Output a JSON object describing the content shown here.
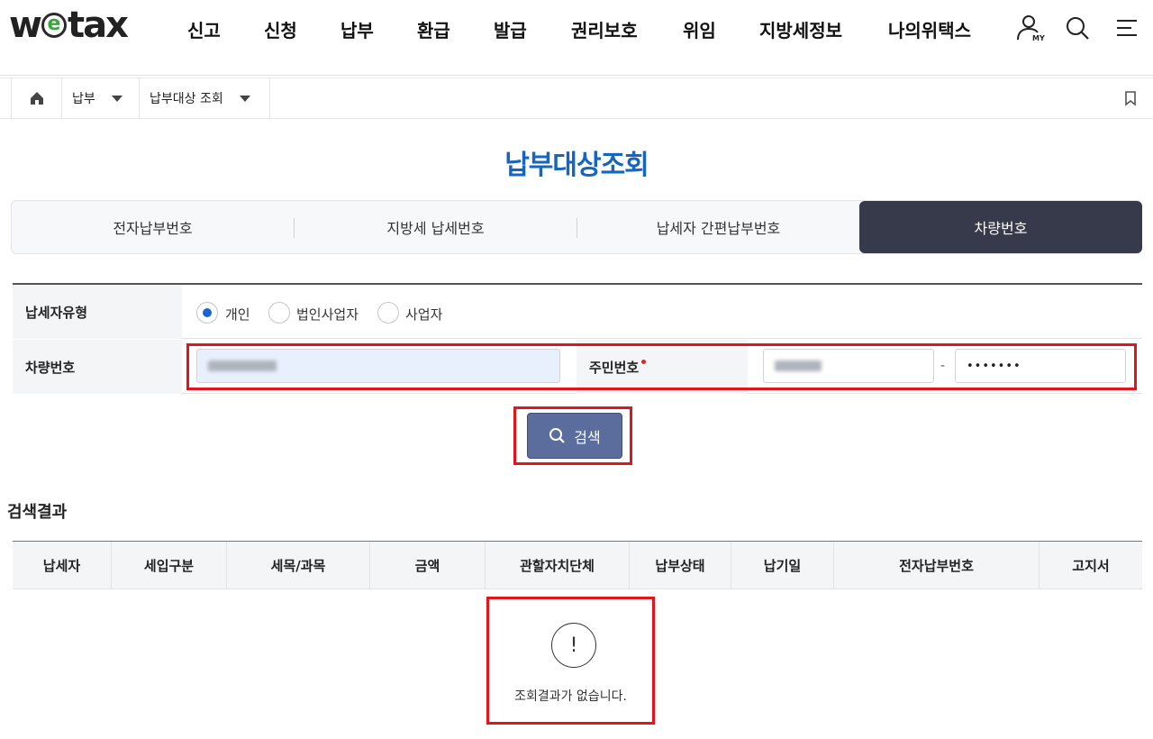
{
  "header": {
    "logo_prefix": "w",
    "logo_e": "e",
    "logo_suffix": "tax",
    "nav": [
      "신고",
      "신청",
      "납부",
      "환급",
      "발급",
      "권리보호",
      "위임",
      "지방세정보",
      "나의위택스"
    ],
    "my_icon_label": "MY",
    "icons": [
      "user-my-icon",
      "search-icon",
      "menu-icon"
    ]
  },
  "breadcrumb": {
    "home_icon": "home-icon",
    "level1": "납부",
    "level2": "납부대상 조회",
    "bookmark_icon": "bookmark-icon"
  },
  "page_title": "납부대상조회",
  "tabs": [
    {
      "label": "전자납부번호",
      "active": false
    },
    {
      "label": "지방세 납세번호",
      "active": false
    },
    {
      "label": "납세자 간편납부번호",
      "active": false
    },
    {
      "label": "차량번호",
      "active": true
    }
  ],
  "form": {
    "taxpayer_type_label": "납세자유형",
    "taxpayer_types": [
      {
        "label": "개인",
        "checked": true
      },
      {
        "label": "법인사업자",
        "checked": false
      },
      {
        "label": "사업자",
        "checked": false
      }
    ],
    "vehicle_label": "차량번호",
    "resident_label": "주민번호",
    "resident_separator": "-",
    "resident_back_value": "•••••••"
  },
  "search_button": "검색",
  "result": {
    "title": "검색결과",
    "columns": [
      "납세자",
      "세입구분",
      "세목/과목",
      "금액",
      "관할자치단체",
      "납부상태",
      "납기일",
      "전자납부번호",
      "고지서"
    ],
    "empty_icon": "!",
    "empty_message": "조회결과가 없습니다."
  },
  "colors": {
    "title_blue": "#1665c0",
    "active_tab": "#373a4a",
    "search_button": "#5a6d9c",
    "highlight_red": "#e2151d"
  }
}
